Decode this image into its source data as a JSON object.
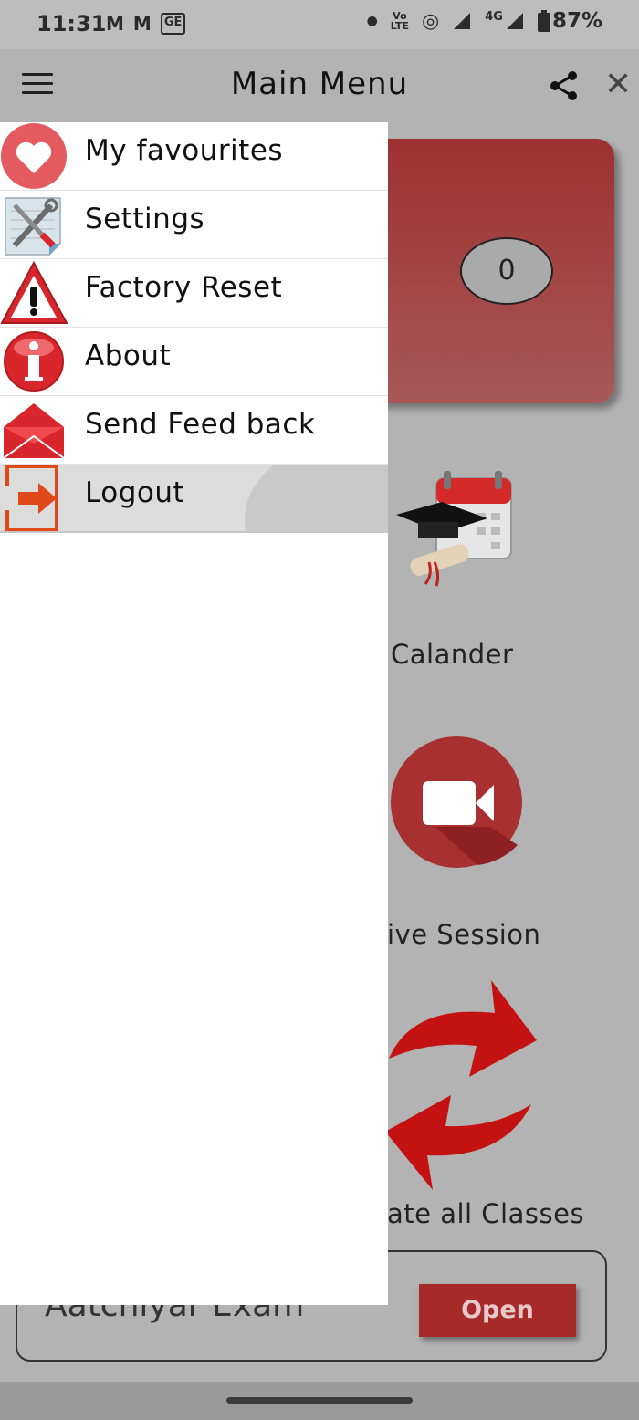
{
  "status_bar": {
    "time": "11:31",
    "left_icons": [
      "M",
      "M",
      "GE"
    ],
    "network": "4G",
    "vo_lte_top": "Vo",
    "vo_lte_bottom": "LTE",
    "battery": "87%"
  },
  "app_bar": {
    "title": "Main Menu"
  },
  "counter_card": {
    "value": "0"
  },
  "background_tiles": [
    {
      "label": "Calander",
      "icon": "calendar-graduation-icon"
    },
    {
      "label": "ive Session",
      "icon": "video-camera-icon"
    },
    {
      "label": "ate all Classes",
      "icon": "refresh-arrows-icon"
    }
  ],
  "exam_card": {
    "title": "Aatchiyar Exam",
    "button_label": "Open"
  },
  "drawer": {
    "items": [
      {
        "label": "My favourites",
        "icon": "heart-icon"
      },
      {
        "label": "Settings",
        "icon": "settings-tools-icon"
      },
      {
        "label": "Factory Reset",
        "icon": "warning-icon"
      },
      {
        "label": "About",
        "icon": "info-icon"
      },
      {
        "label": "Send Feed back",
        "icon": "envelope-icon"
      },
      {
        "label": "Logout",
        "icon": "logout-icon"
      }
    ]
  },
  "colors": {
    "accent_red": "#a72a2a",
    "scrim": "#b3b3b3",
    "drawer_bg": "#ffffff"
  }
}
